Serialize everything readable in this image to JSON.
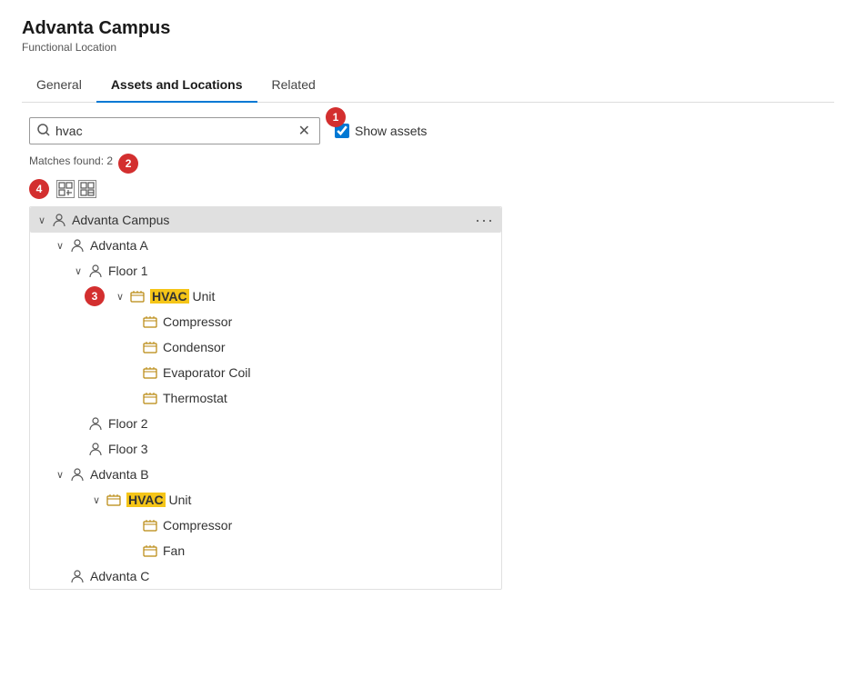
{
  "page": {
    "title": "Advanta Campus",
    "subtitle": "Functional Location"
  },
  "tabs": [
    {
      "id": "general",
      "label": "General",
      "active": false
    },
    {
      "id": "assets-locations",
      "label": "Assets and Locations",
      "active": true
    },
    {
      "id": "related",
      "label": "Related",
      "active": false
    }
  ],
  "toolbar": {
    "search_placeholder": "hvac",
    "search_value": "hvac",
    "show_assets_label": "Show assets",
    "show_assets_checked": true,
    "callout_1": "1",
    "matches_label": "Matches found: 2",
    "callout_2": "2",
    "callout_3": "3",
    "callout_4": "4"
  },
  "tree": {
    "root": {
      "label": "Advanta Campus",
      "highlighted": true,
      "children": [
        {
          "label": "Advanta A",
          "children": [
            {
              "label": "Floor 1",
              "children": [
                {
                  "label": "HVAC Unit",
                  "highlight": "HVAC",
                  "is_asset": true,
                  "children": [
                    {
                      "label": "Compressor",
                      "is_asset": true
                    },
                    {
                      "label": "Condensor",
                      "is_asset": true
                    },
                    {
                      "label": "Evaporator Coil",
                      "is_asset": true
                    },
                    {
                      "label": "Thermostat",
                      "is_asset": true
                    }
                  ]
                }
              ]
            },
            {
              "label": "Floor 2"
            },
            {
              "label": "Floor 3"
            }
          ]
        },
        {
          "label": "Advanta B",
          "children": [
            {
              "label": "HVAC Unit",
              "highlight": "HVAC",
              "is_asset": true,
              "children": [
                {
                  "label": "Compressor",
                  "is_asset": true
                },
                {
                  "label": "Fan",
                  "is_asset": true
                }
              ]
            }
          ]
        },
        {
          "label": "Advanta C"
        }
      ]
    }
  },
  "icons": {
    "search": "🔍",
    "location": "⚙",
    "asset": "📦",
    "expand_all": "⊞",
    "collapse_all": "⊟",
    "chevron_down": "∨",
    "chevron_right": "›",
    "more": "···"
  }
}
